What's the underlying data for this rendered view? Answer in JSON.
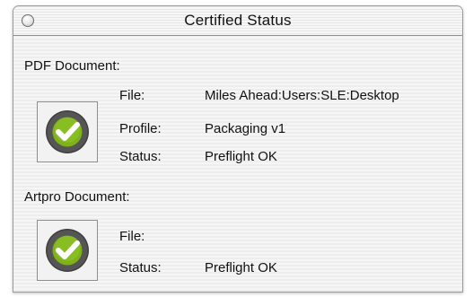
{
  "window": {
    "title": "Certified Status"
  },
  "pdf_section": {
    "heading": "PDF Document:",
    "file_label": "File:",
    "file_value": "Miles Ahead:Users:SLE:Desktop",
    "profile_label": "Profile:",
    "profile_value": "Packaging v1",
    "status_label": "Status:",
    "status_value": "Preflight OK",
    "icon": "green-checkmark-icon"
  },
  "artpro_section": {
    "heading": "Artpro Document:",
    "file_label": "File:",
    "file_value": "",
    "status_label": "Status:",
    "status_value": "Preflight OK",
    "icon": "green-checkmark-icon"
  },
  "colors": {
    "check_green": "#7fb21a",
    "badge_dark": "#4a4a4a"
  }
}
